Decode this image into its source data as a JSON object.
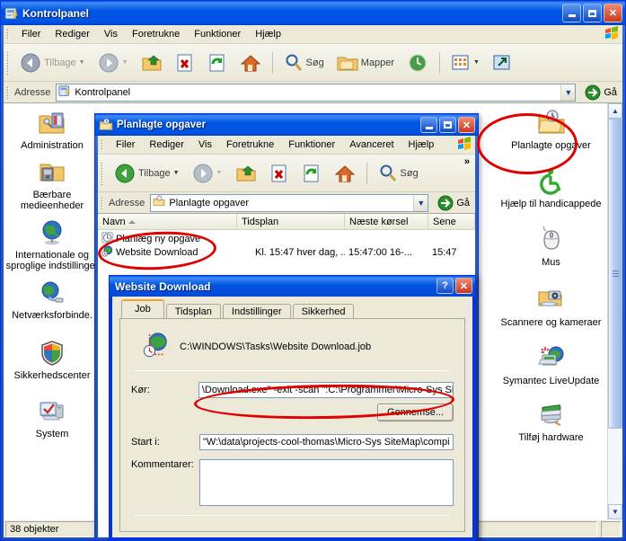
{
  "main_window": {
    "title": "Kontrolpanel",
    "title_icon": "control-panel-icon",
    "menus": [
      "Filer",
      "Rediger",
      "Vis",
      "Foretrukne",
      "Funktioner",
      "Hjælp"
    ],
    "toolbar": {
      "back_label": "Tilbage",
      "forward_label": "",
      "search_label": "Søg",
      "folders_label": "Mapper",
      "up_icon": "up-folder-icon",
      "delete_icon": "delete-x-icon",
      "refresh_icon": "refresh-icon",
      "home_icon": "home-icon",
      "search_icon": "search-magnifier-icon",
      "folders_icon": "folders-icon",
      "history_icon": "history-globe-icon",
      "views_icon": "views-grid-icon",
      "move_icon": "move-to-icon",
      "chevron_icon": "chevron-down-icon"
    },
    "address": {
      "label": "Adresse",
      "value": "Kontrolpanel",
      "icon": "control-panel-icon",
      "go_label": "Gå"
    },
    "statusbar": {
      "objects": "38 objekter"
    }
  },
  "control_panel_left": {
    "items": [
      {
        "label": "Administration",
        "icon": "admin-tools-icon"
      },
      {
        "label": "Bærbare medieenheder",
        "icon": "portable-media-icon"
      },
      {
        "label": "Internationale og sproglige indstillinger",
        "icon": "globe-icon"
      },
      {
        "label": "Netværksforbinde.",
        "icon": "network-connections-icon"
      },
      {
        "label": "Sikkerhedscenter",
        "icon": "security-shield-icon"
      },
      {
        "label": "System",
        "icon": "system-computer-icon"
      }
    ]
  },
  "control_panel_right": {
    "items": [
      {
        "label": "Planlagte opgaver",
        "icon": "scheduled-tasks-icon",
        "highlighted": true
      },
      {
        "label": "Hjælp til handicappede",
        "icon": "accessibility-icon"
      },
      {
        "label": "Mus",
        "icon": "mouse-icon"
      },
      {
        "label": "Scannere og kameraer",
        "icon": "scanners-cameras-icon"
      },
      {
        "label": "Symantec LiveUpdate",
        "icon": "symantec-liveupdate-icon"
      },
      {
        "label": "Tilføj hardware",
        "icon": "add-hardware-icon"
      }
    ]
  },
  "tasks_window": {
    "title": "Planlagte opgaver",
    "title_icon": "scheduled-tasks-folder-icon",
    "menus": [
      "Filer",
      "Rediger",
      "Vis",
      "Foretrukne",
      "Funktioner",
      "Avanceret",
      "Hjælp"
    ],
    "toolbar": {
      "back_label": "Tilbage",
      "search_label": "Søg",
      "overflow_label": "»"
    },
    "address": {
      "label": "Adresse",
      "value": "Planlagte opgaver",
      "go_label": "Gå"
    },
    "columns": [
      "Navn",
      "Tidsplan",
      "Næste kørsel",
      "Sene"
    ],
    "rows": [
      {
        "icon": "new-task-wizard-icon",
        "name": "Planlæg ny opgave",
        "schedule": "",
        "next_run": "",
        "last_run": ""
      },
      {
        "icon": "website-download-task-icon",
        "name": "Website Download",
        "schedule": "Kl. 15:47 hver dag, ...",
        "next_run": "15:47:00  16-...",
        "last_run": "15:47"
      }
    ]
  },
  "dialog": {
    "title": "Website Download",
    "help_label": "?",
    "close_label": "✕",
    "tabs": [
      {
        "label": "Job",
        "active": true
      },
      {
        "label": "Tidsplan",
        "active": false
      },
      {
        "label": "Indstillinger",
        "active": false
      },
      {
        "label": "Sikkerhed",
        "active": false
      }
    ],
    "job_icon": "website-download-task-icon",
    "job_path": "C:\\WINDOWS\\Tasks\\Website Download.job",
    "fields": {
      "run_label": "Kør:",
      "run_value": "\\Download.exe\" -exit -scan \":C:\\Programmer\\Micro-Sys Si",
      "browse_label": "Gennemse...",
      "start_in_label": "Start i:",
      "start_in_value": "\"W:\\data\\projects-cool-thomas\\Micro-Sys SiteMap\\compi",
      "comments_label": "Kommentarer:",
      "comments_value": ""
    }
  },
  "annotations": {
    "color": "#e00000",
    "marks": [
      {
        "name": "scheduled-tasks-icon-circle",
        "target": "Planlagte opgaver control panel icon"
      },
      {
        "name": "task-list-circle",
        "target": "Planlæg ny opgave / Website Download rows"
      },
      {
        "name": "command-line-circle",
        "target": "Kør command line field"
      }
    ]
  }
}
